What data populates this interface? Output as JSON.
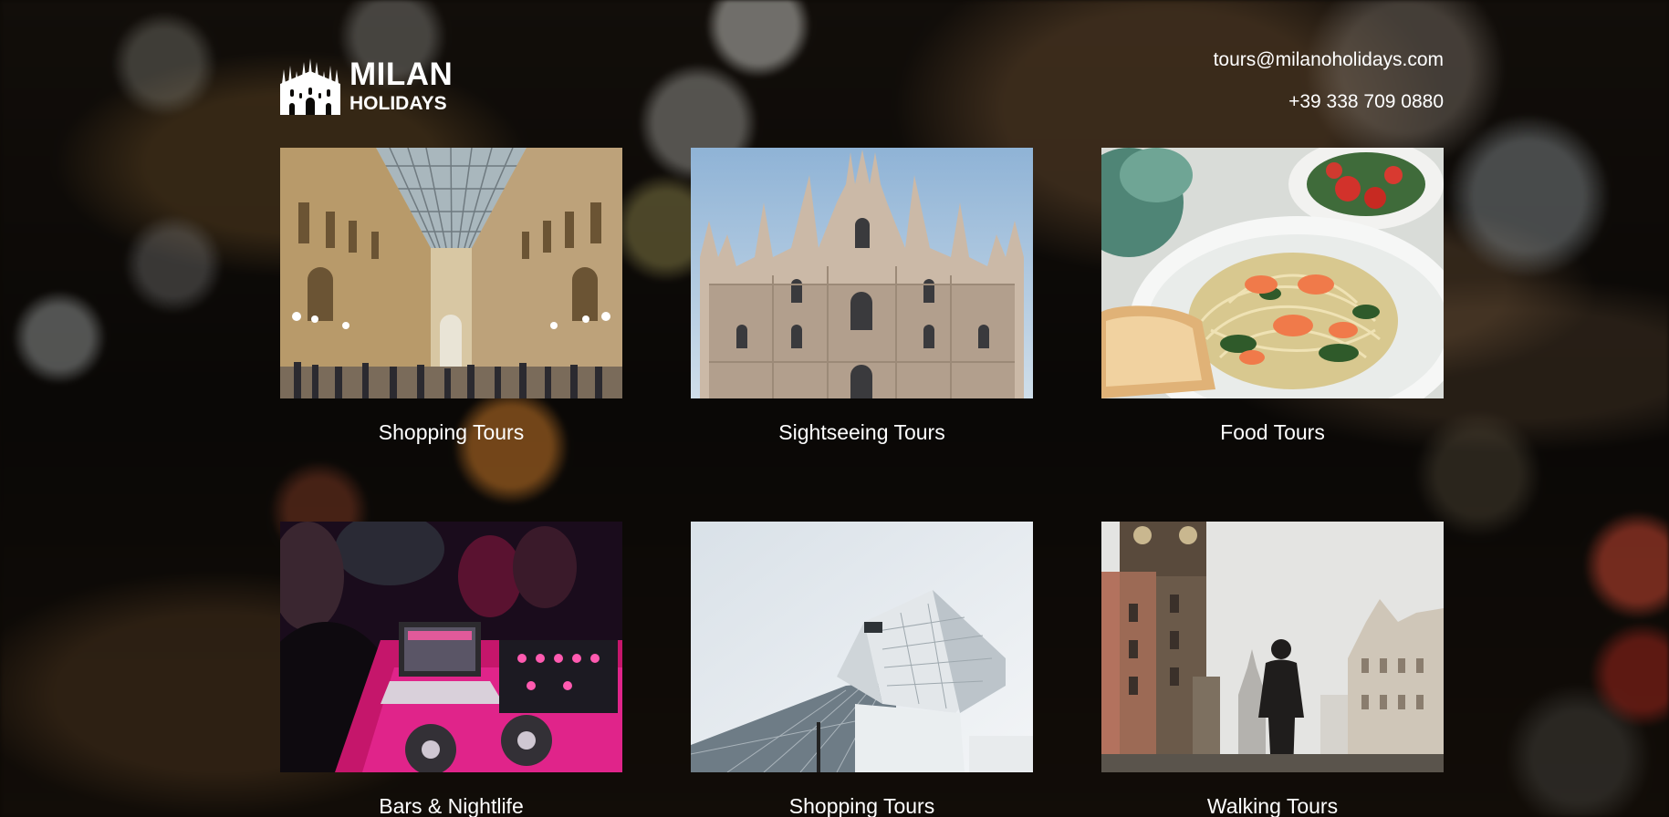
{
  "brand": {
    "title": "MILAN",
    "subtitle": "HOLIDAYS",
    "logo_icon": "duomo-cathedral-icon"
  },
  "contact": {
    "email": "tours@milanoholidays.com",
    "phone": "+39 338 709 0880"
  },
  "tours": [
    {
      "label": "Shopping Tours",
      "image": "galleria-vittorio-emanuele-photo"
    },
    {
      "label": "Sightseeing Tours",
      "image": "duomo-di-milano-photo"
    },
    {
      "label": "Food Tours",
      "image": "shrimp-pasta-plate-photo"
    },
    {
      "label": "Bars & Nightlife",
      "image": "dj-mixer-nightclub-photo"
    },
    {
      "label": "Shopping Tours",
      "image": "modern-glass-building-photo"
    },
    {
      "label": "Walking Tours",
      "image": "old-town-square-walker-photo"
    }
  ]
}
